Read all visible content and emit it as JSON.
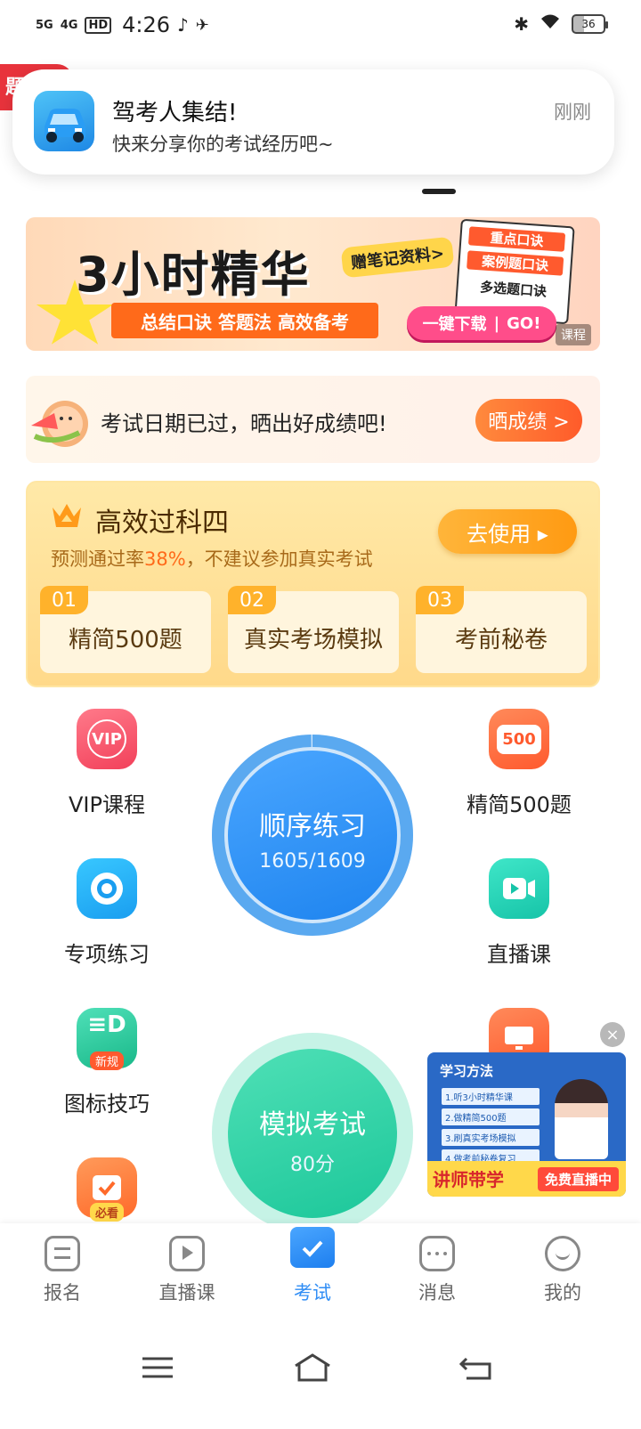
{
  "status_bar": {
    "net1": "5G",
    "net2": "4G",
    "hd": "HD",
    "time": "4:26",
    "battery": "36"
  },
  "notification": {
    "title": "驾考人集结!",
    "subtitle": "快来分享你的考试经历吧~",
    "time": "刚刚"
  },
  "banner": {
    "headline": "3小时精华",
    "note": "赠笔记资料>",
    "tagline": "总结口诀 答题法 高效备考",
    "card_line1": "重点口诀",
    "card_line2": "案例题口诀",
    "card_line3": "多选题口诀",
    "button_left": "一键下载",
    "button_right": "GO!",
    "corner": "课程"
  },
  "exam_date": {
    "text": "考试日期已过，晒出好成绩吧!",
    "button": "晒成绩 >"
  },
  "efficient": {
    "title": "高效过科四",
    "subtitle_prefix": "预测通过率",
    "rate": "38%",
    "subtitle_suffix": "，不建议参加真实考试",
    "button": "去使用 ▸",
    "items": [
      {
        "num": "01",
        "label": "精简500题"
      },
      {
        "num": "02",
        "label": "真实考场模拟"
      },
      {
        "num": "03",
        "label": "考前秘卷"
      }
    ]
  },
  "grid": {
    "vip": "VIP课程",
    "vip_badge": "VIP",
    "simplified": "精简500题",
    "simplified_badge": "500",
    "special": "专项练习",
    "live": "直播课",
    "icon_skill": "图标技巧",
    "icon_skill_badge": "新规",
    "must_badge": "必看"
  },
  "sequential": {
    "title": "顺序练习",
    "progress": "1605/1609",
    "progress_fraction": 0.9975
  },
  "mock": {
    "title": "模拟考试",
    "score": "80分"
  },
  "ad": {
    "title": "学习方法",
    "list": [
      "1.听3小时精华课",
      "2.做精简500题",
      "3.刷真实考场模拟",
      "4.做考前秘卷复习"
    ],
    "tag_left": "讲师带学",
    "tag_right": "免费直播中",
    "close": "×"
  },
  "bottom_nav": {
    "items": [
      {
        "label": "报名",
        "icon": "document-icon"
      },
      {
        "label": "直播课",
        "icon": "tv-play-icon"
      },
      {
        "label": "考试",
        "icon": "folder-check-icon"
      },
      {
        "label": "消息",
        "icon": "chat-bubble-icon"
      },
      {
        "label": "我的",
        "icon": "smile-face-icon"
      }
    ],
    "active_index": 2
  },
  "colors": {
    "accent_blue": "#2f8df5",
    "accent_orange": "#ff6a1a",
    "mock_green": "#2fd6a8"
  }
}
